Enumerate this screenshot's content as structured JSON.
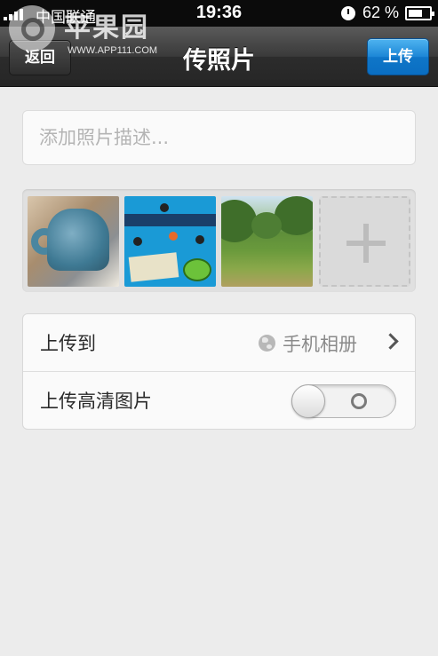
{
  "status_bar": {
    "carrier": "中国联通",
    "time": "19:36",
    "battery": "62 %"
  },
  "watermark": {
    "name": "苹果园",
    "url": "WWW.APP111.COM"
  },
  "nav": {
    "back_label": "返回",
    "title": "传照片",
    "upload_label": "上传"
  },
  "description": {
    "placeholder": "添加照片描述..."
  },
  "photos": [
    {
      "name": "mug-photo"
    },
    {
      "name": "cut-the-rope-photo"
    },
    {
      "name": "park-photo"
    }
  ],
  "settings": {
    "upload_to_label": "上传到",
    "upload_to_value": "手机相册",
    "hd_label": "上传高清图片",
    "hd_enabled": false
  },
  "icons": {
    "add": "plus-icon",
    "location": "globe-icon",
    "disclosure": "chevron-right-icon"
  },
  "colors": {
    "upload_button": "#1c86d6",
    "nav_bar": "#2c2c2c",
    "background": "#ececec"
  }
}
